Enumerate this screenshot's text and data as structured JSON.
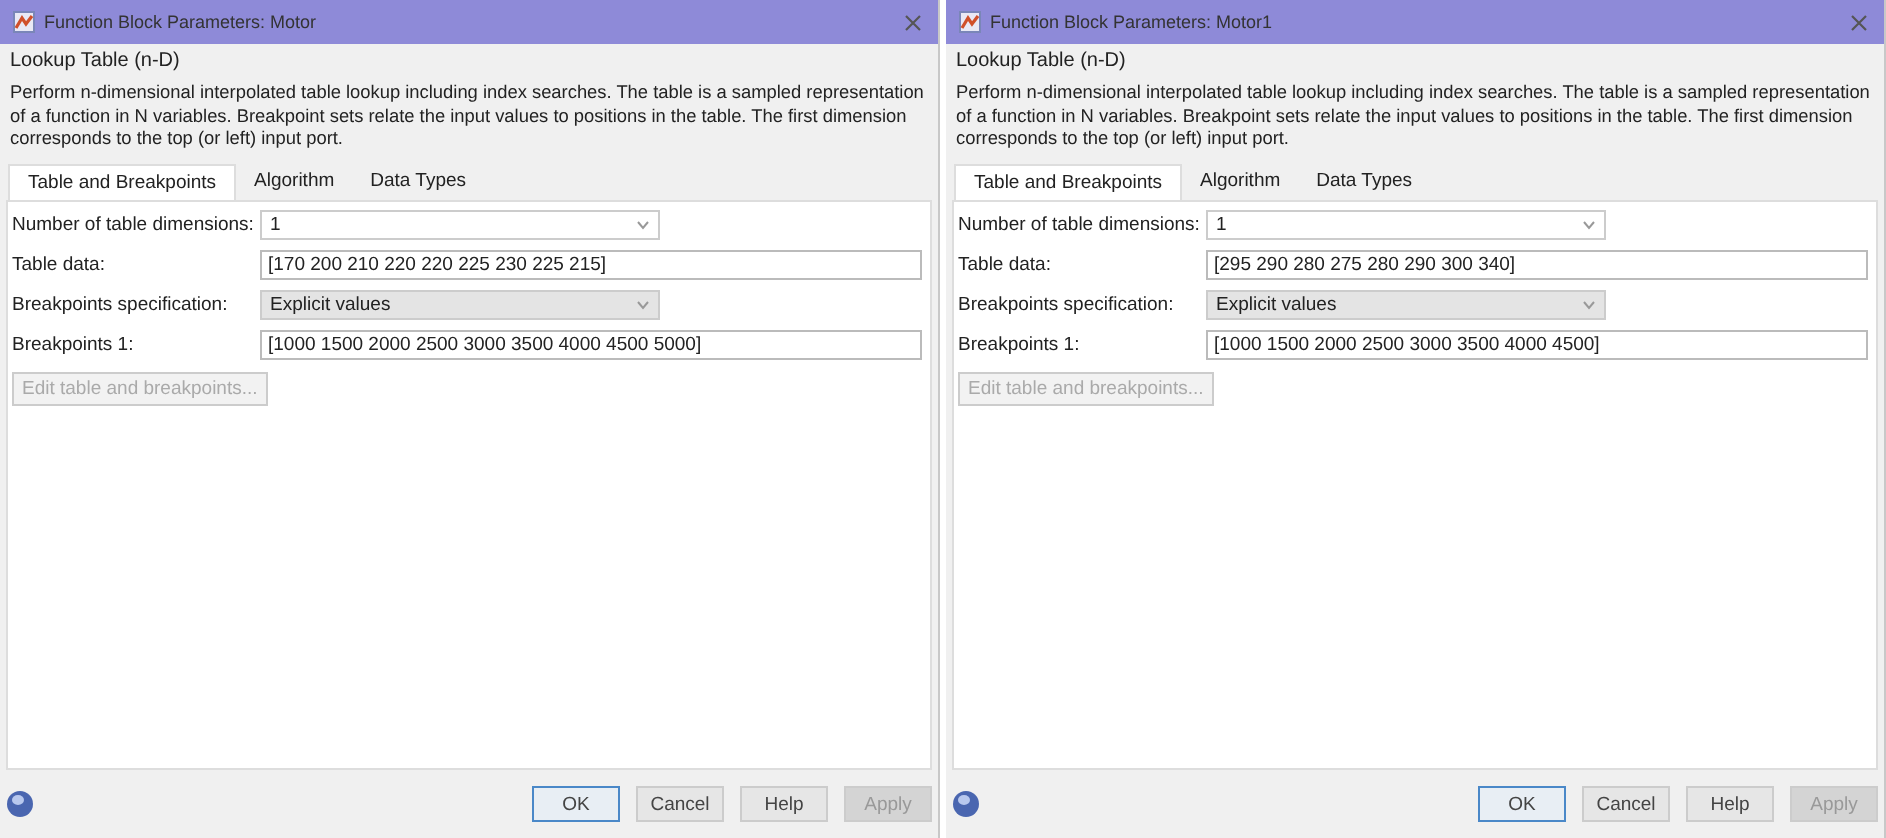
{
  "dialogs": [
    {
      "title": "Function Block Parameters: Motor",
      "block_name": "Lookup Table (n-D)",
      "description": "Perform n-dimensional interpolated table lookup including index searches. The table is a sampled representation of a function in N variables. Breakpoint sets relate the input values to positions in the table. The first dimension corresponds to the top (or left) input port.",
      "tabs": [
        {
          "label": "Table and Breakpoints",
          "selected": true
        },
        {
          "label": "Algorithm",
          "selected": false
        },
        {
          "label": "Data Types",
          "selected": false
        }
      ],
      "fields": [
        {
          "kind": "dropdown",
          "label": "Number of table dimensions:",
          "value": "1",
          "disabled": false
        },
        {
          "kind": "text",
          "label": "Table data:",
          "value": "[170 200 210 220 220 225 230 225 215]"
        },
        {
          "kind": "dropdown",
          "label": "Breakpoints specification:",
          "value": "Explicit values",
          "disabled": true
        },
        {
          "kind": "text",
          "label": "Breakpoints 1:",
          "value": "[1000 1500 2000 2500 3000 3500 4000 4500 5000]"
        }
      ],
      "edit_button": {
        "label": "Edit table and breakpoints...",
        "disabled": true
      },
      "buttons": [
        {
          "label": "OK",
          "default": true,
          "disabled": false
        },
        {
          "label": "Cancel",
          "default": false,
          "disabled": false
        },
        {
          "label": "Help",
          "default": false,
          "disabled": false
        },
        {
          "label": "Apply",
          "default": false,
          "disabled": true
        }
      ]
    },
    {
      "title": "Function Block Parameters: Motor1",
      "block_name": "Lookup Table (n-D)",
      "description": "Perform n-dimensional interpolated table lookup including index searches. The table is a sampled representation of a function in N variables. Breakpoint sets relate the input values to positions in the table. The first dimension corresponds to the top (or left) input port.",
      "tabs": [
        {
          "label": "Table and Breakpoints",
          "selected": true
        },
        {
          "label": "Algorithm",
          "selected": false
        },
        {
          "label": "Data Types",
          "selected": false
        }
      ],
      "fields": [
        {
          "kind": "dropdown",
          "label": "Number of table dimensions:",
          "value": "1",
          "disabled": false
        },
        {
          "kind": "text",
          "label": "Table data:",
          "value": "[295 290 280 275 280 290 300 340]"
        },
        {
          "kind": "dropdown",
          "label": "Breakpoints specification:",
          "value": "Explicit values",
          "disabled": true
        },
        {
          "kind": "text",
          "label": "Breakpoints 1:",
          "value": "[1000 1500 2000 2500 3000 3500 4000 4500]"
        }
      ],
      "edit_button": {
        "label": "Edit table and breakpoints...",
        "disabled": true
      },
      "buttons": [
        {
          "label": "OK",
          "default": true,
          "disabled": false
        },
        {
          "label": "Cancel",
          "default": false,
          "disabled": false
        },
        {
          "label": "Help",
          "default": false,
          "disabled": false
        },
        {
          "label": "Apply",
          "default": false,
          "disabled": true
        }
      ]
    }
  ]
}
